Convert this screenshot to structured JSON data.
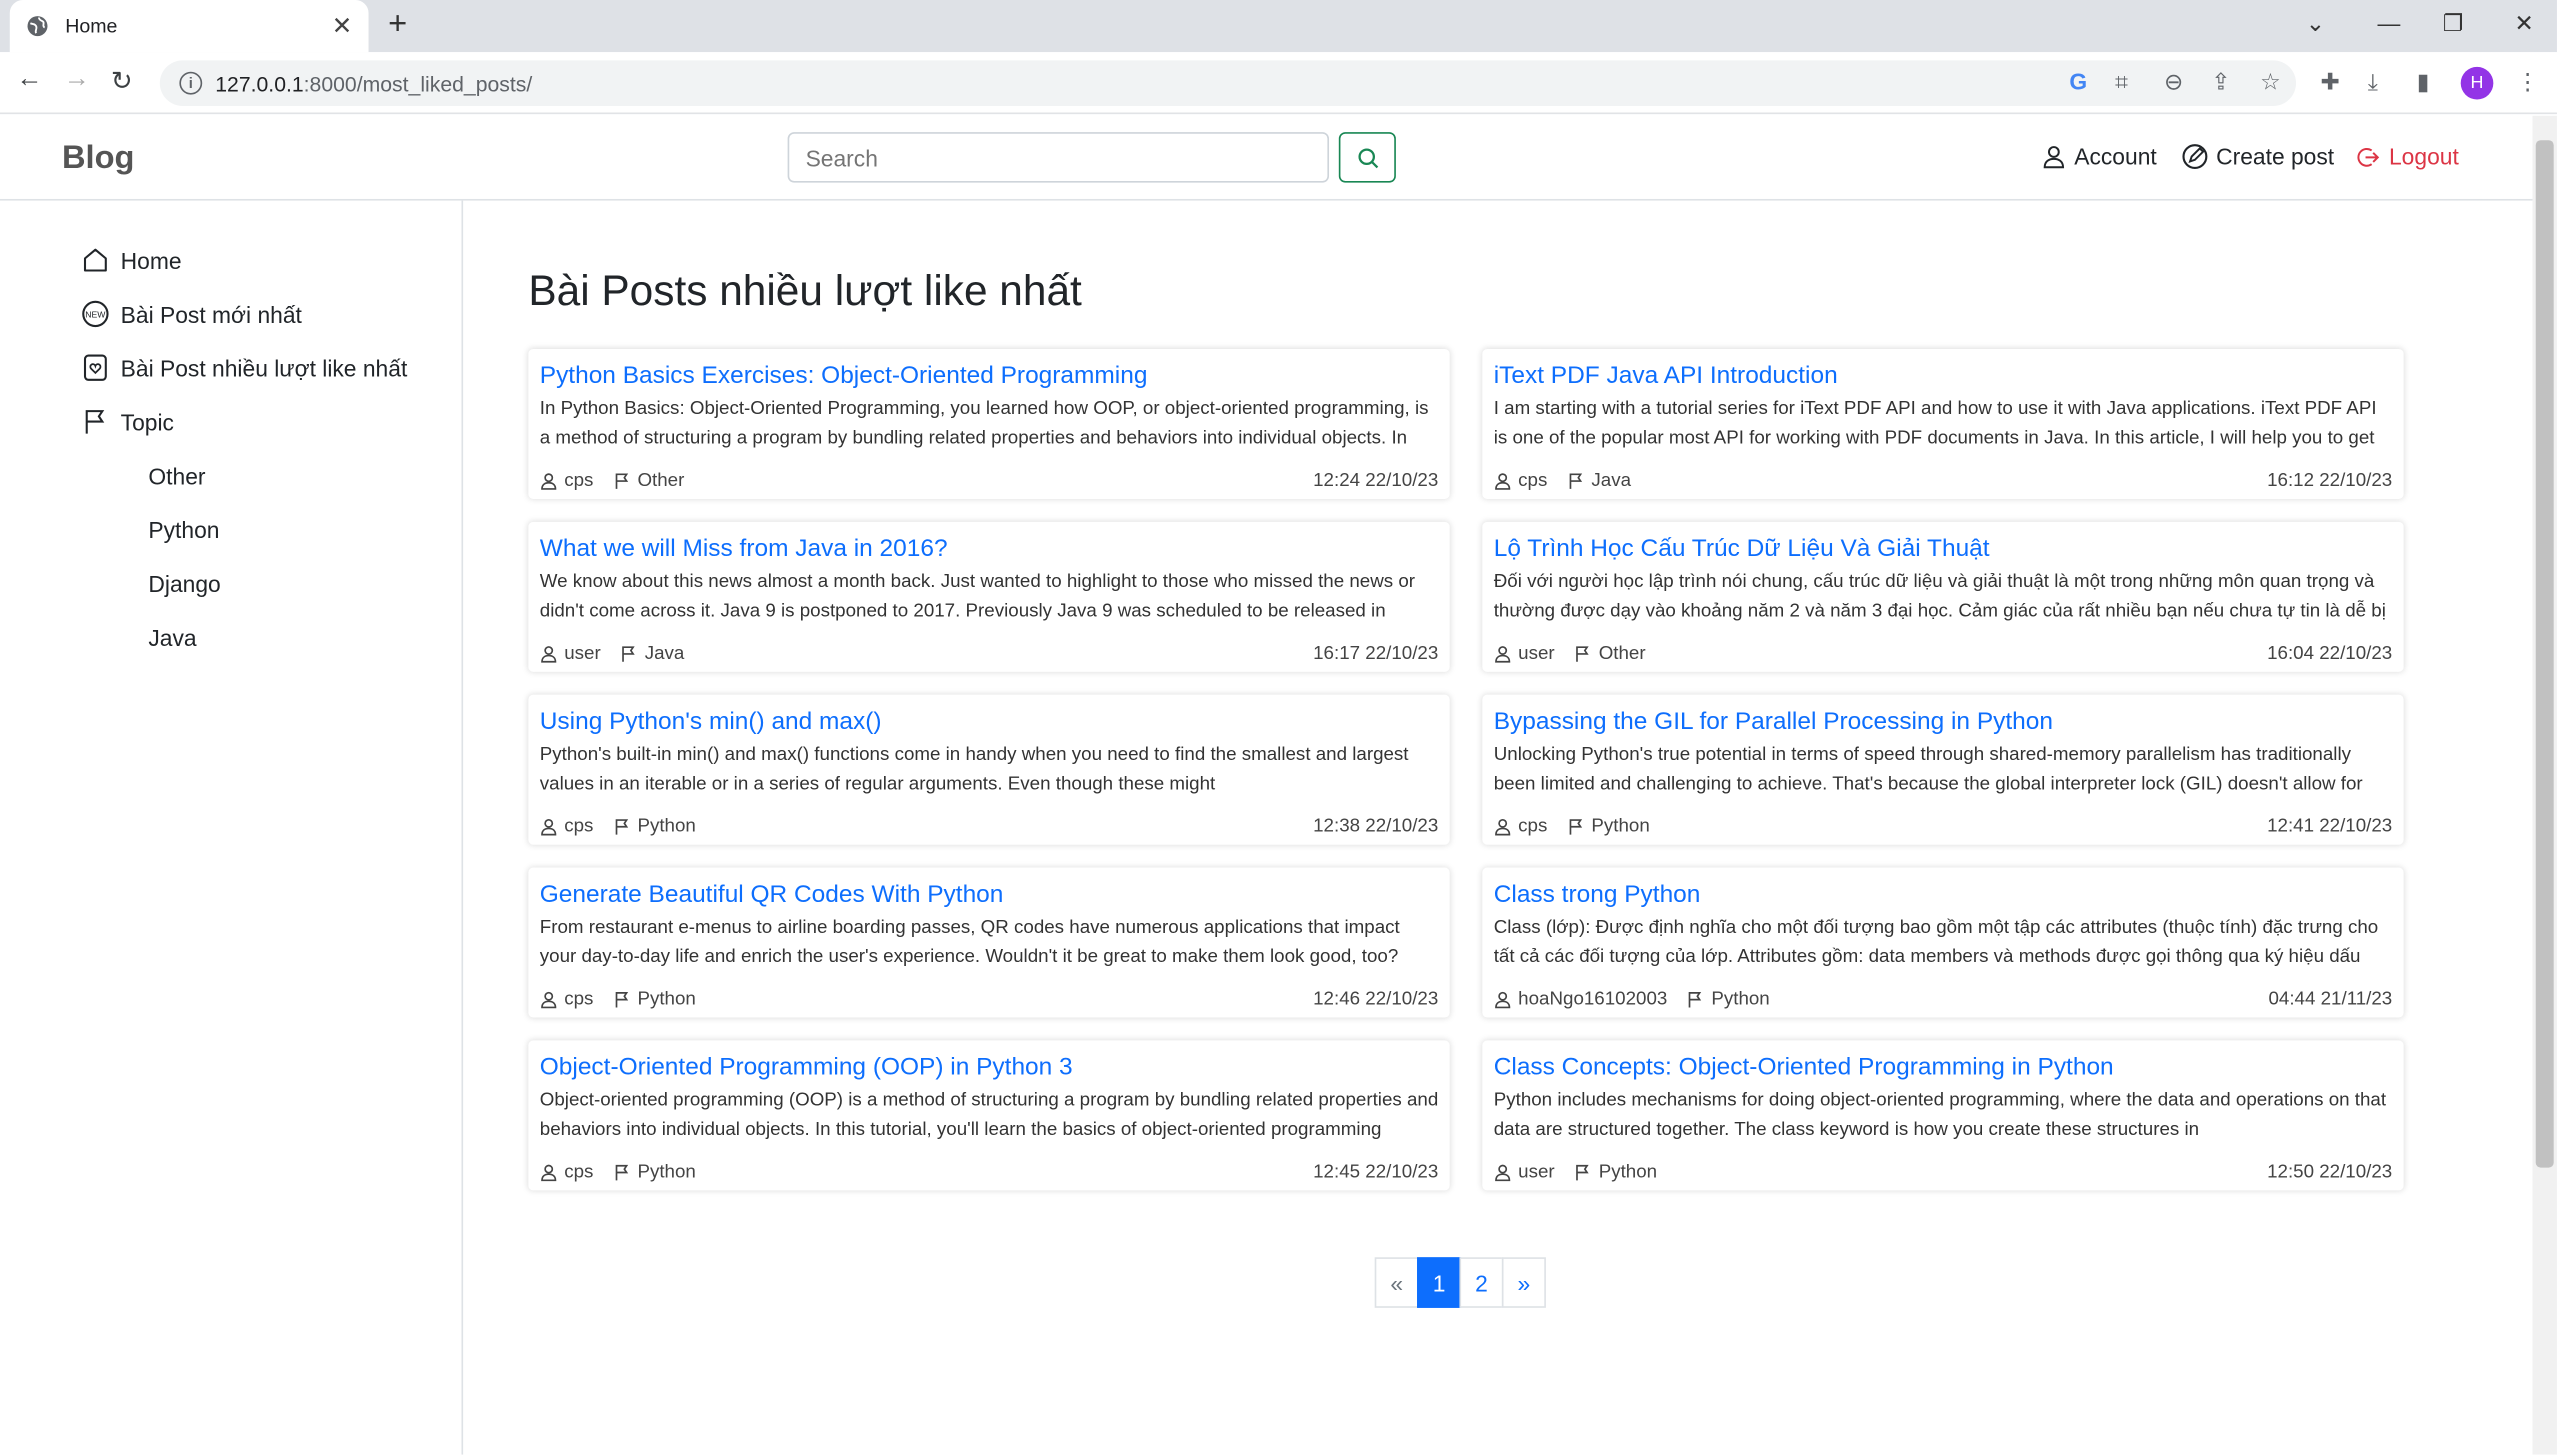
{
  "browser": {
    "tab_title": "Home",
    "url_host": "127.0.0.1",
    "url_path": ":8000/most_liked_posts/",
    "profile_initial": "H"
  },
  "header": {
    "brand": "Blog",
    "search_placeholder": "Search",
    "account": "Account",
    "create_post": "Create post",
    "logout": "Logout"
  },
  "sidebar": {
    "items": [
      {
        "label": "Home"
      },
      {
        "label": "Bài Post mới nhất"
      },
      {
        "label": "Bài Post nhiều lượt like nhất"
      },
      {
        "label": "Topic"
      }
    ],
    "topics": [
      "Other",
      "Python",
      "Django",
      "Java"
    ]
  },
  "main": {
    "title": "Bài Posts nhiều lượt like nhất",
    "posts": [
      {
        "title": "Python Basics Exercises: Object-Oriented Programming",
        "excerpt": "In Python Basics: Object-Oriented Programming, you learned how OOP, or object-oriented programming, is a method of structuring a program by bundling related properties and behaviors into individual objects. In",
        "author": "cps",
        "topic": "Other",
        "date": "12:24 22/10/23"
      },
      {
        "title": "iText PDF Java API Introduction",
        "excerpt": "I am starting with a tutorial series for iText PDF API and how to use it with Java applications. iText PDF API is one of the popular most API for working with PDF documents in Java. In this article, I will help you to get",
        "author": "cps",
        "topic": "Java",
        "date": "16:12 22/10/23"
      },
      {
        "title": "What we will Miss from Java in 2016?",
        "excerpt": "  We know about this news almost a month back. Just wanted to highlight to those who missed the news or didn't come across it. Java 9 is postponed to 2017. Previously Java 9 was scheduled to be released in",
        "author": "user",
        "topic": "Java",
        "date": "16:17 22/10/23"
      },
      {
        "title": "Lộ Trình Học Cấu Trúc Dữ Liệu Và Giải Thuật",
        "excerpt": "Đối với người học lập trình nói chung, cấu trúc dữ liệu và giải thuật là một trong những môn quan trọng và thường được dạy vào khoảng năm 2 và năm 3 đại học. Cảm giác của rất nhiều bạn nếu chưa tự tin là dễ bị",
        "author": "user",
        "topic": "Other",
        "date": "16:04 22/10/23"
      },
      {
        "title": "Using Python's min() and max()",
        "excerpt": "Python's built-in min() and max() functions come in handy when you need to find the smallest and largest values in an iterable or in a series of regular arguments. Even though these might",
        "author": "cps",
        "topic": "Python",
        "date": "12:38 22/10/23"
      },
      {
        "title": "Bypassing the GIL for Parallel Processing in Python",
        "excerpt": "Unlocking Python's true potential in terms of speed through shared-memory parallelism has traditionally been limited and challenging to achieve. That's because the global interpreter lock (GIL) doesn't allow for",
        "author": "cps",
        "topic": "Python",
        "date": "12:41 22/10/23"
      },
      {
        "title": "Generate Beautiful QR Codes With Python",
        "excerpt": "From restaurant e-menus to airline boarding passes, QR codes have numerous applications that impact your day-to-day life and enrich the user's experience. Wouldn't it be great to make them look good, too?",
        "author": "cps",
        "topic": "Python",
        "date": "12:46 22/10/23"
      },
      {
        "title": "Class trong Python",
        "excerpt": "Class (lớp): Được định nghĩa cho một đối tượng bao gồm một tập các attributes (thuộc tính) đặc trưng cho tất cả các đối tượng của lớp. Attributes gồm: data members và methods được gọi thông qua ký hiệu dấu",
        "author": "hoaNgo16102003",
        "topic": "Python",
        "date": "04:44 21/11/23"
      },
      {
        "title": "Object-Oriented Programming (OOP) in Python 3",
        "excerpt": "Object-oriented programming (OOP) is a method of structuring a program by bundling related properties and behaviors into individual objects. In this tutorial, you'll learn the basics of object-oriented programming",
        "author": "cps",
        "topic": "Python",
        "date": "12:45 22/10/23"
      },
      {
        "title": "Class Concepts: Object-Oriented Programming in Python",
        "excerpt": "Python includes mechanisms for doing object-oriented programming, where the data and operations on that data are structured together. The class keyword is how you create these structures in",
        "author": "user",
        "topic": "Python",
        "date": "12:50 22/10/23"
      }
    ]
  },
  "pagination": {
    "prev": "«",
    "pages": [
      "1",
      "2"
    ],
    "next": "»",
    "active": "1"
  },
  "colors": {
    "link": "#0d6efd",
    "logout": "#dc3545",
    "search_button": "#198754"
  }
}
